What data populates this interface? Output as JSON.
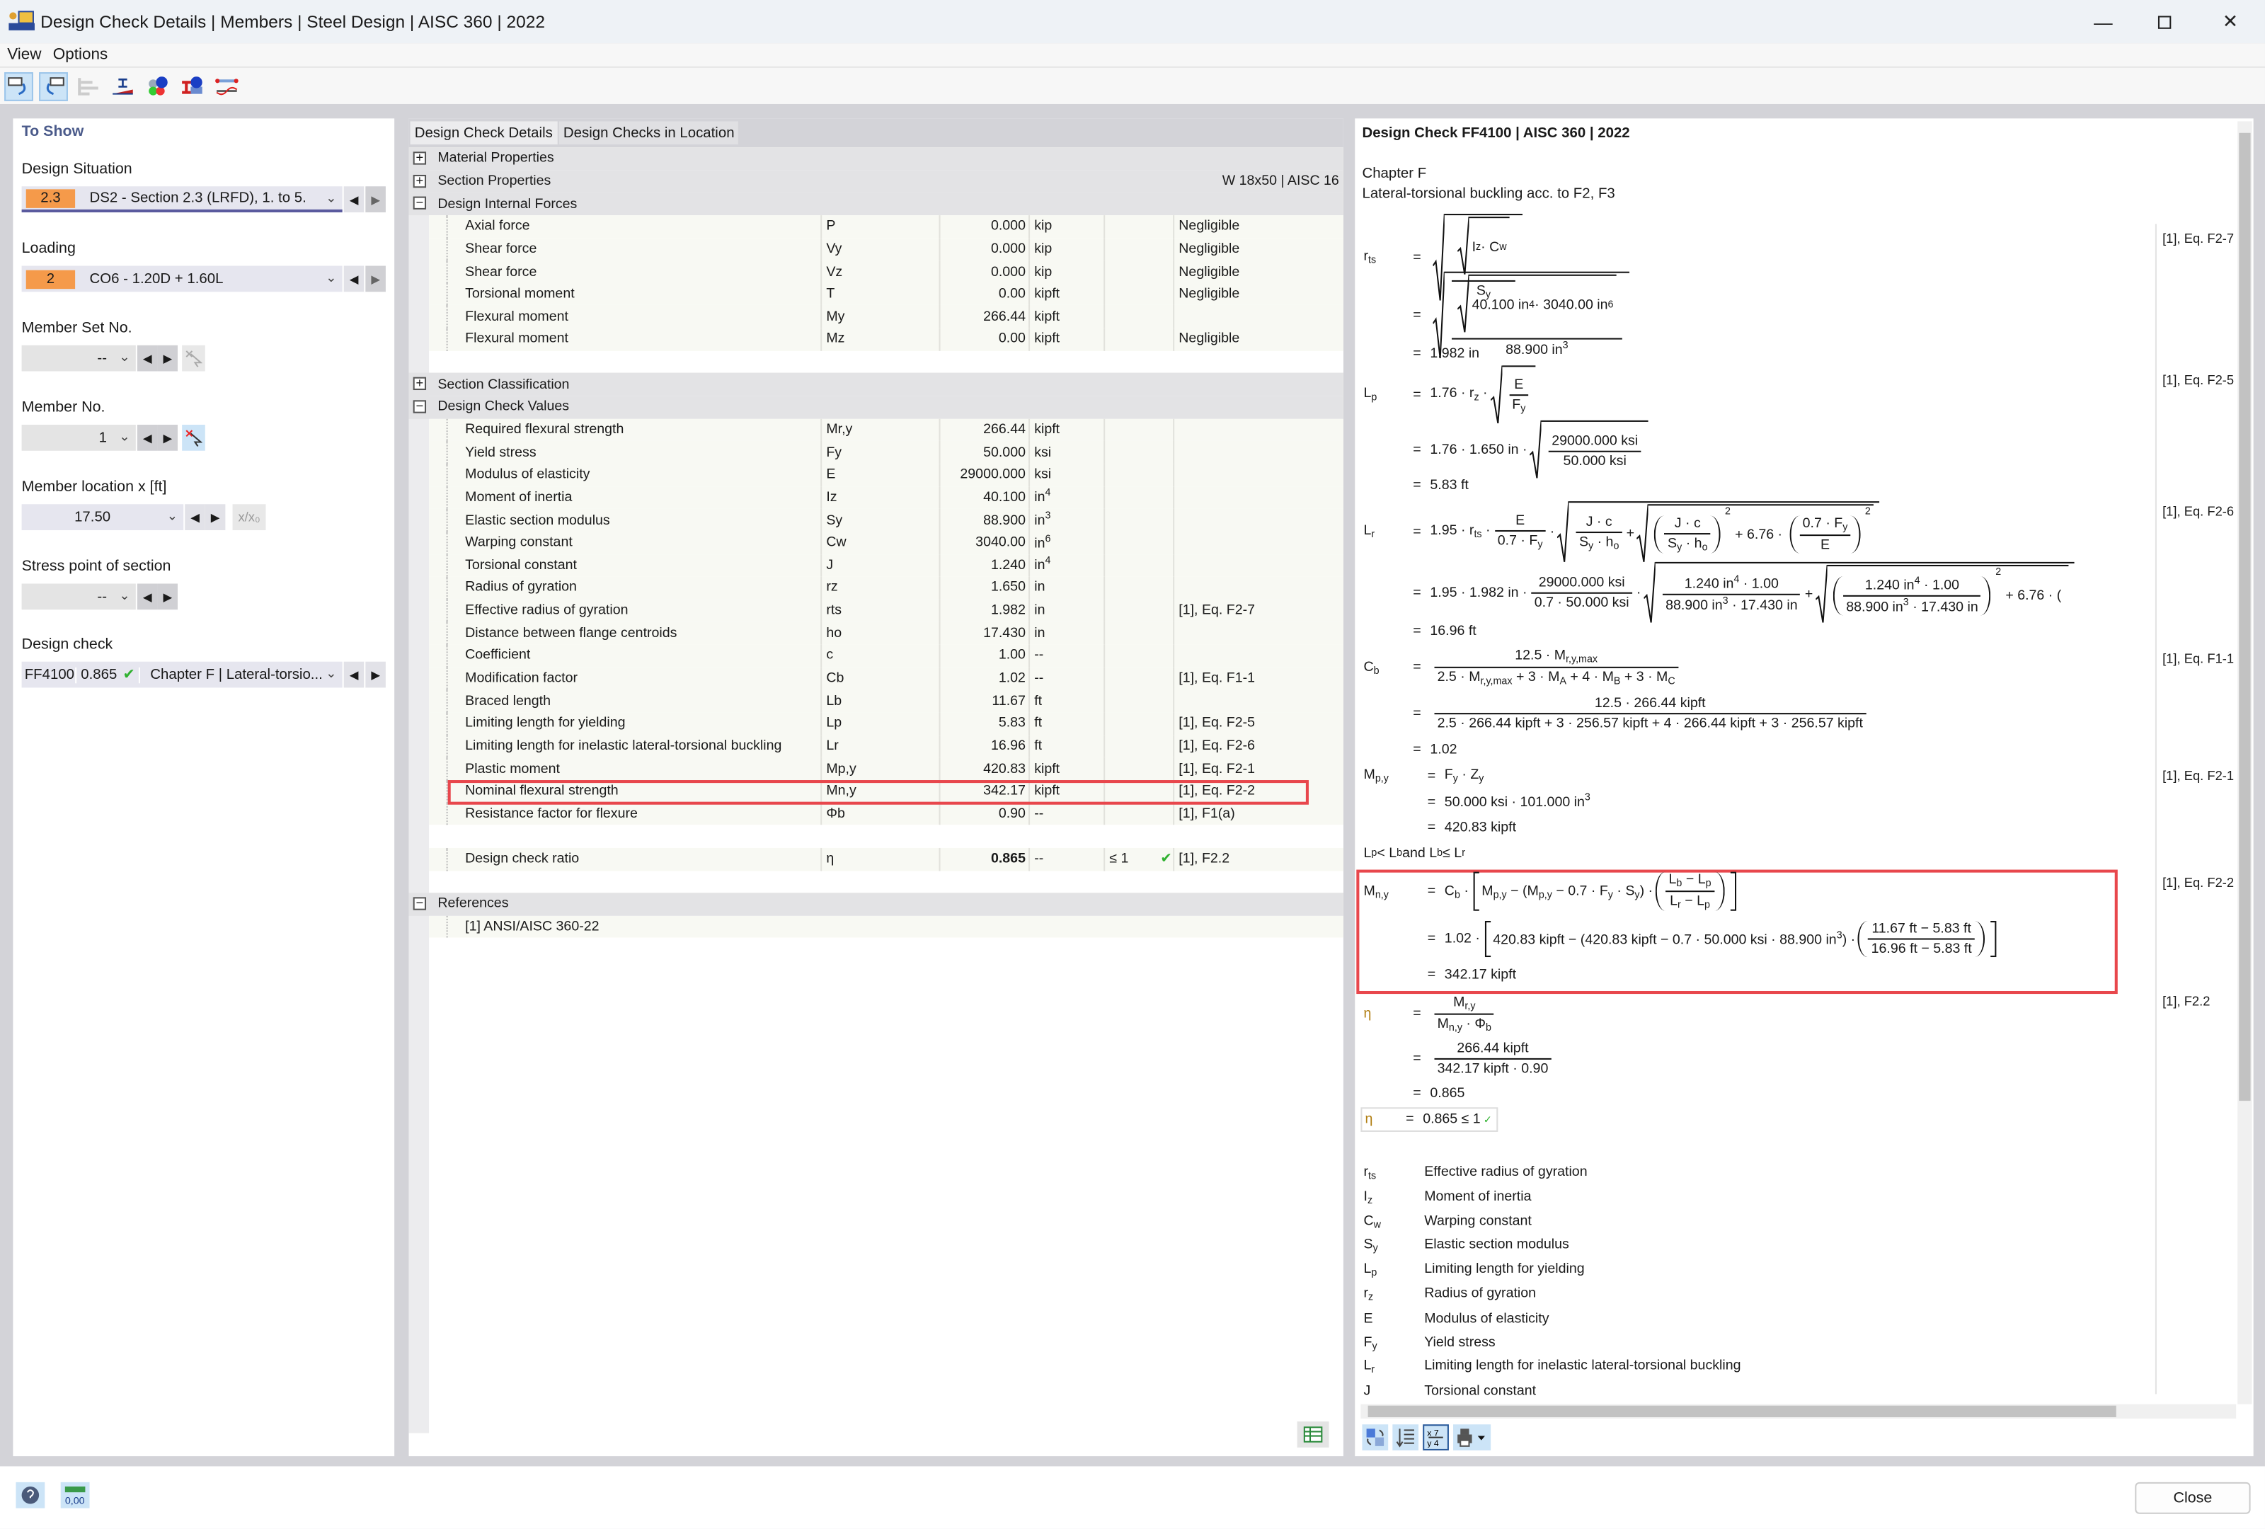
{
  "window": {
    "title": "Design Check Details | Members | Steel Design | AISC 360 | 2022"
  },
  "menu": [
    "View",
    "Options"
  ],
  "toolbar_icons": [
    "previous-window-icon",
    "next-window-icon",
    "bar-chart-icon",
    "section-icon",
    "info-colors-icon",
    "section-info-icon",
    "member-deflection-icon"
  ],
  "left": {
    "heading": "To Show",
    "design_situation": {
      "label": "Design Situation",
      "badge": "2.3",
      "value": "DS2 - Section 2.3 (LRFD), 1. to 5.",
      "badge_color": "#f59a4a"
    },
    "loading": {
      "label": "Loading",
      "badge": "2",
      "value": "CO6 - 1.20D + 1.60L"
    },
    "member_set": {
      "label": "Member Set No.",
      "value": "--"
    },
    "member": {
      "label": "Member No.",
      "value": "1"
    },
    "location": {
      "label": "Member location x [ft]",
      "value": "17.50",
      "relative_button": "x/x₀"
    },
    "stress_point": {
      "label": "Stress point of section",
      "value": "--"
    },
    "design_check": {
      "label": "Design check",
      "id": "FF4100",
      "ratio": "0.865",
      "value": "Chapter F | Lateral-torsio..."
    }
  },
  "tabs": [
    "Design Check Details",
    "Design Checks in Location"
  ],
  "tree": {
    "material_properties": "Material Properties",
    "section_properties": {
      "label": "Section Properties",
      "section": "W 18x50 | AISC 16"
    },
    "internal_forces": {
      "label": "Design Internal Forces",
      "rows": [
        [
          "Axial force",
          "P",
          "0.000",
          "kip",
          "",
          "Negligible"
        ],
        [
          "Shear force",
          "Vy",
          "0.000",
          "kip",
          "",
          "Negligible"
        ],
        [
          "Shear force",
          "Vz",
          "0.000",
          "kip",
          "",
          "Negligible"
        ],
        [
          "Torsional moment",
          "T",
          "0.00",
          "kipft",
          "",
          "Negligible"
        ],
        [
          "Flexural moment",
          "My",
          "266.44",
          "kipft",
          "",
          ""
        ],
        [
          "Flexural moment",
          "Mz",
          "0.00",
          "kipft",
          "",
          "Negligible"
        ]
      ]
    },
    "section_classification": "Section Classification",
    "design_check_values": {
      "label": "Design Check Values",
      "rows": [
        [
          "Required flexural strength",
          "Mr,y",
          "266.44",
          "kipft",
          "",
          ""
        ],
        [
          "Yield stress",
          "Fy",
          "50.000",
          "ksi",
          "",
          ""
        ],
        [
          "Modulus of elasticity",
          "E",
          "29000.000",
          "ksi",
          "",
          ""
        ],
        [
          "Moment of inertia",
          "Iz",
          "40.100",
          "in^{4}",
          "",
          ""
        ],
        [
          "Elastic section modulus",
          "Sy",
          "88.900",
          "in^{3}",
          "",
          ""
        ],
        [
          "Warping constant",
          "Cw",
          "3040.00",
          "in^{6}",
          "",
          ""
        ],
        [
          "Torsional constant",
          "J",
          "1.240",
          "in^{4}",
          "",
          ""
        ],
        [
          "Radius of gyration",
          "rz",
          "1.650",
          "in",
          "",
          ""
        ],
        [
          "Effective radius of gyration",
          "rts",
          "1.982",
          "in",
          "",
          "[1], Eq. F2-7"
        ],
        [
          "Distance between flange centroids",
          "ho",
          "17.430",
          "in",
          "",
          ""
        ],
        [
          "Coefficient",
          "c",
          "1.00",
          "--",
          "",
          ""
        ],
        [
          "Modification factor",
          "Cb",
          "1.02",
          "--",
          "",
          "[1], Eq. F1-1"
        ],
        [
          "Braced length",
          "Lb",
          "11.67",
          "ft",
          "",
          ""
        ],
        [
          "Limiting length for yielding",
          "Lp",
          "5.83",
          "ft",
          "",
          "[1], Eq. F2-5"
        ],
        [
          "Limiting length for inelastic lateral-torsional buckling",
          "Lr",
          "16.96",
          "ft",
          "",
          "[1], Eq. F2-6"
        ],
        [
          "Plastic moment",
          "Mp,y",
          "420.83",
          "kipft",
          "",
          "[1], Eq. F2-1"
        ],
        [
          "Nominal flexural strength",
          "Mn,y",
          "342.17",
          "kipft",
          "",
          "[1], Eq. F2-2"
        ],
        [
          "Resistance factor for flexure",
          "Φb",
          "0.90",
          "--",
          "",
          "[1], F1(a)"
        ]
      ]
    },
    "ratio_row": [
      "Design check ratio",
      "η",
      "0.865",
      "--",
      "≤ 1",
      "[1], F2.2"
    ],
    "references": {
      "label": "References",
      "items": [
        "[1]  ANSI/AISC 360-22"
      ]
    },
    "highlight_color": "#e8474c",
    "ok_color": "#2fb12f"
  },
  "detail": {
    "title": "Design Check FF4100 | AISC 360 | 2022",
    "chapter": "Chapter F",
    "subtitle": "Lateral-torsional buckling acc. to F2, F3",
    "eq": "=",
    "rts": {
      "lhs": "r_{ts}",
      "n1": "I_{z} · C_{w}",
      "d1": "S_{y}",
      "n2": "40.100 in^{4} · 3040.00 in^{6}",
      "d2": "88.900 in^{3}",
      "res": "1.982 in",
      "ref": "[1], Eq. F2-7"
    },
    "lp": {
      "lhs": "L_{p}",
      "a1": "1.76 · r_{z} ·",
      "n1": "E",
      "d1": "F_{y}",
      "a2": "1.76 · 1.650 in ·",
      "n2": "29000.000 ksi",
      "d2": "50.000 ksi",
      "res": "5.83 ft",
      "ref": "[1], Eq. F2-5"
    },
    "lr": {
      "lhs": "L_{r}",
      "a1": "1.95 · r_{ts} ·",
      "fn1": "E",
      "fd1": "0.7 · F_{y}",
      "dot": "·",
      "jn": "J · c",
      "jd": "S_{y} · h_{o}",
      "plus": "+",
      "sq2": "2",
      "b676": "+ 6.76 ·",
      "en": "0.7 · F_{y}",
      "ed": "E",
      "a2": "1.95 · 1.982 in ·",
      "fn2": "29000.000 ksi",
      "fd2": "0.7 · 50.000 ksi",
      "jn2": "1.240 in^{4} · 1.00",
      "jd2": "88.900 in^{3} · 17.430 in",
      "cut": "+ 6.76 · (",
      "res": "16.96 ft",
      "ref": "[1], Eq. F2-6"
    },
    "cb": {
      "lhs": "C_{b}",
      "n1": "12.5 · M_{r,y,max}",
      "d1": "2.5 · M_{r,y,max} + 3 · M_{A} + 4 · M_{B} + 3 · M_{C}",
      "n2": "12.5 · 266.44 kipft",
      "d2": "2.5 · 266.44 kipft + 3 · 256.57 kipft + 4 · 266.44 kipft + 3 · 256.57 kipft",
      "res": "1.02",
      "ref": "[1], Eq. F1-1"
    },
    "mp": {
      "lhs": "M_{p,y}",
      "l1": "F_{y} · Z_{y}",
      "l2": "50.000 ksi · 101.000 in^{3}",
      "res": "420.83 kipft",
      "ref": "[1], Eq. F2-1"
    },
    "cond": "L_{p} < L_{b} and L_{b} ≤ L_{r}",
    "mn": {
      "lhs": "M_{n,y}",
      "a1": "C_{b} ·",
      "b1": "M_{p,y} − (M_{p,y} − 0.7 · F_{y} · S_{y}) ·",
      "n1": "L_{b} − L_{p}",
      "d1": "L_{r} − L_{p}",
      "a2": "1.02 ·",
      "b2": "420.83 kipft − (420.83 kipft − 0.7 · 50.000 ksi · 88.900 in^{3}) ·",
      "n2": "11.67 ft − 5.83 ft",
      "d2": "16.96 ft − 5.83 ft",
      "res": "342.17 kipft",
      "ref": "[1], Eq. F2-2"
    },
    "eta": {
      "lhs": "η",
      "n1": "M_{r,y}",
      "d1": "M_{n,y} · Φ_{b}",
      "n2": "266.44 kipft",
      "d2": "342.17 kipft · 0.90",
      "res": "0.865",
      "final": "0.865 ≤ 1",
      "ok": "✓",
      "ref": "[1], F2.2"
    },
    "legend": [
      [
        "r_{ts}",
        "Effective radius of gyration"
      ],
      [
        "I_{z}",
        "Moment of inertia"
      ],
      [
        "C_{w}",
        "Warping constant"
      ],
      [
        "S_{y}",
        "Elastic section modulus"
      ],
      [
        "L_{p}",
        "Limiting length for yielding"
      ],
      [
        "r_{z}",
        "Radius of gyration"
      ],
      [
        "E",
        "Modulus of elasticity"
      ],
      [
        "F_{y}",
        "Yield stress"
      ],
      [
        "L_{r}",
        "Limiting length for inelastic lateral-torsional buckling"
      ],
      [
        "J",
        "Torsional constant"
      ]
    ]
  },
  "footer": {
    "close": "Close"
  }
}
